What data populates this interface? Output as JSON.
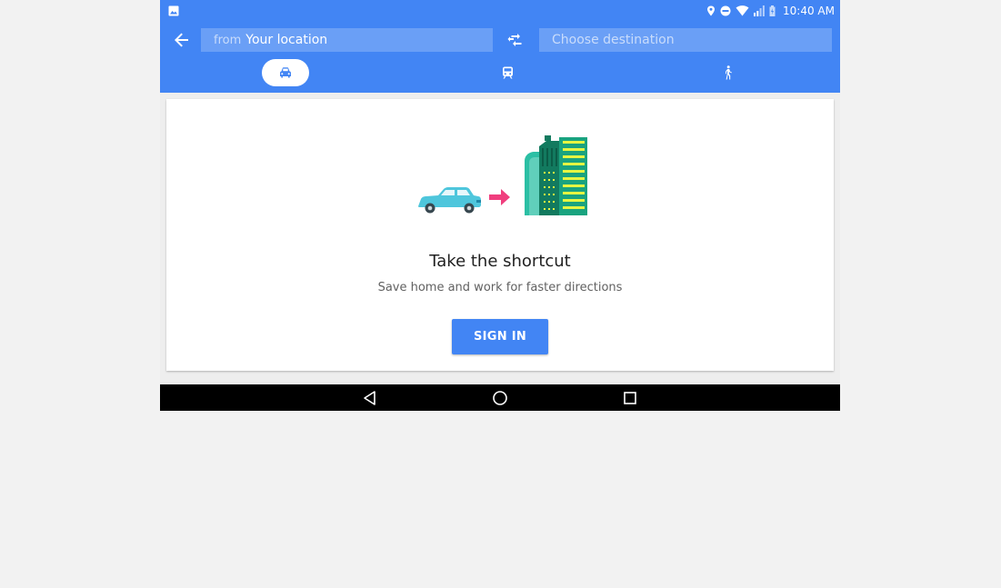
{
  "status_bar": {
    "time": "10:40 AM",
    "icons": [
      "image-icon",
      "location-pin-icon",
      "do-not-disturb-icon",
      "wifi-icon",
      "signal-icon",
      "battery-icon"
    ]
  },
  "search": {
    "from_prefix": "from",
    "from_value": "Your location",
    "destination_placeholder": "Choose destination"
  },
  "modes": [
    {
      "name": "drive",
      "icon": "car-icon",
      "selected": true
    },
    {
      "name": "transit",
      "icon": "train-icon",
      "selected": false
    },
    {
      "name": "walk",
      "icon": "walk-icon",
      "selected": false
    }
  ],
  "card": {
    "title": "Take the shortcut",
    "subtitle": "Save home and work for faster directions",
    "button_label": "SIGN IN"
  },
  "nav": {
    "icons": [
      "nav-back-icon",
      "nav-home-icon",
      "nav-recents-icon"
    ]
  },
  "colors": {
    "header_blue": "#4285f4",
    "field_blue": "#6a9ff6",
    "button_blue": "#4285f4",
    "arrow_pink": "#f03e7e",
    "car_teal": "#4ec6dc",
    "building_green": "#1aa37f"
  }
}
